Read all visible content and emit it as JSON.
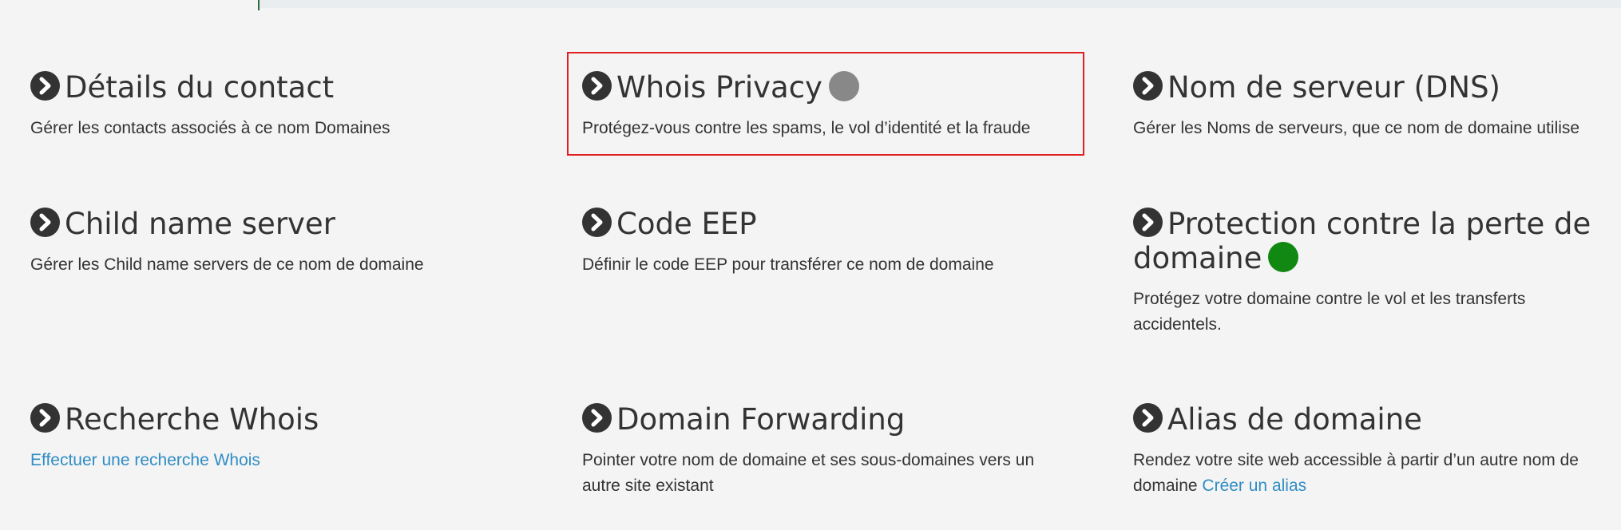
{
  "colors": {
    "status_grey": "#888888",
    "status_green": "#118811",
    "link": "#2f8dc4",
    "highlight": "#e02020"
  },
  "cards": {
    "contact_details": {
      "title": "Détails du contact",
      "desc": "Gérer les contacts associés à ce nom Domaines",
      "icon": "chevron-right-circle-icon"
    },
    "whois_privacy": {
      "title": "Whois Privacy",
      "desc": "Protégez-vous contre les spams, le vol d’identité et la fraude",
      "icon": "chevron-right-circle-icon",
      "status": "off"
    },
    "dns": {
      "title": "Nom de serveur (DNS)",
      "desc": "Gérer les Noms de serveurs, que ce nom de domaine utilise",
      "icon": "chevron-right-circle-icon"
    },
    "child_ns": {
      "title": "Child name server",
      "desc": "Gérer les Child name servers de ce nom de domaine",
      "icon": "chevron-right-circle-icon"
    },
    "eep": {
      "title": "Code EEP",
      "desc": "Définir le code EEP pour transférer ce nom de domaine",
      "icon": "chevron-right-circle-icon"
    },
    "domain_lock": {
      "title": "Protection contre la perte de domaine",
      "desc": "Protégez votre domaine contre le vol et les transferts accidentels.",
      "icon": "chevron-right-circle-icon",
      "status": "on"
    },
    "whois_lookup": {
      "title": "Recherche Whois",
      "link": "Effectuer une recherche Whois",
      "icon": "chevron-right-circle-icon"
    },
    "forwarding": {
      "title": "Domain Forwarding",
      "desc": "Pointer votre nom de domaine et ses sous-domaines vers un autre site existant",
      "icon": "chevron-right-circle-icon"
    },
    "alias": {
      "title": "Alias de domaine",
      "desc": "Rendez votre site web accessible à partir d’un autre nom de domaine",
      "link": "Créer un alias",
      "icon": "chevron-right-circle-icon"
    }
  }
}
